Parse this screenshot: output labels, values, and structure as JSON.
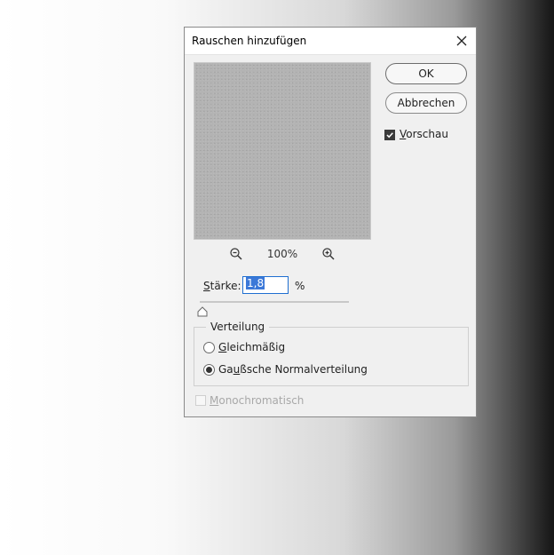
{
  "dialog": {
    "title": "Rauschen hinzufügen",
    "close_icon": "close-icon"
  },
  "preview": {
    "zoom_level": "100%",
    "zoom_out_icon": "zoom-out-icon",
    "zoom_in_icon": "zoom-in-icon"
  },
  "buttons": {
    "ok_label": "OK",
    "cancel_label": "Abbrechen"
  },
  "vorschau": {
    "mnemonic": "V",
    "rest": "orschau",
    "checked": true
  },
  "staerke": {
    "mnemonic": "S",
    "rest": "tärke:",
    "value": "1,8",
    "unit": "%",
    "slider_fraction": 0.018
  },
  "verteilung": {
    "legend": "Verteilung",
    "options": [
      {
        "mnemonic": "G",
        "rest": "leichmäßig",
        "selected": false
      },
      {
        "pre": "Ga",
        "mnemonic": "u",
        "rest": "ßsche Normalverteilung",
        "selected": true
      }
    ]
  },
  "monochromatisch": {
    "mnemonic": "M",
    "rest": "onochromatisch",
    "checked": false,
    "disabled": true
  },
  "colors": {
    "dialog_bg": "#f0f0f0",
    "accent": "#1f6fd1",
    "selection": "#3b78d8"
  }
}
